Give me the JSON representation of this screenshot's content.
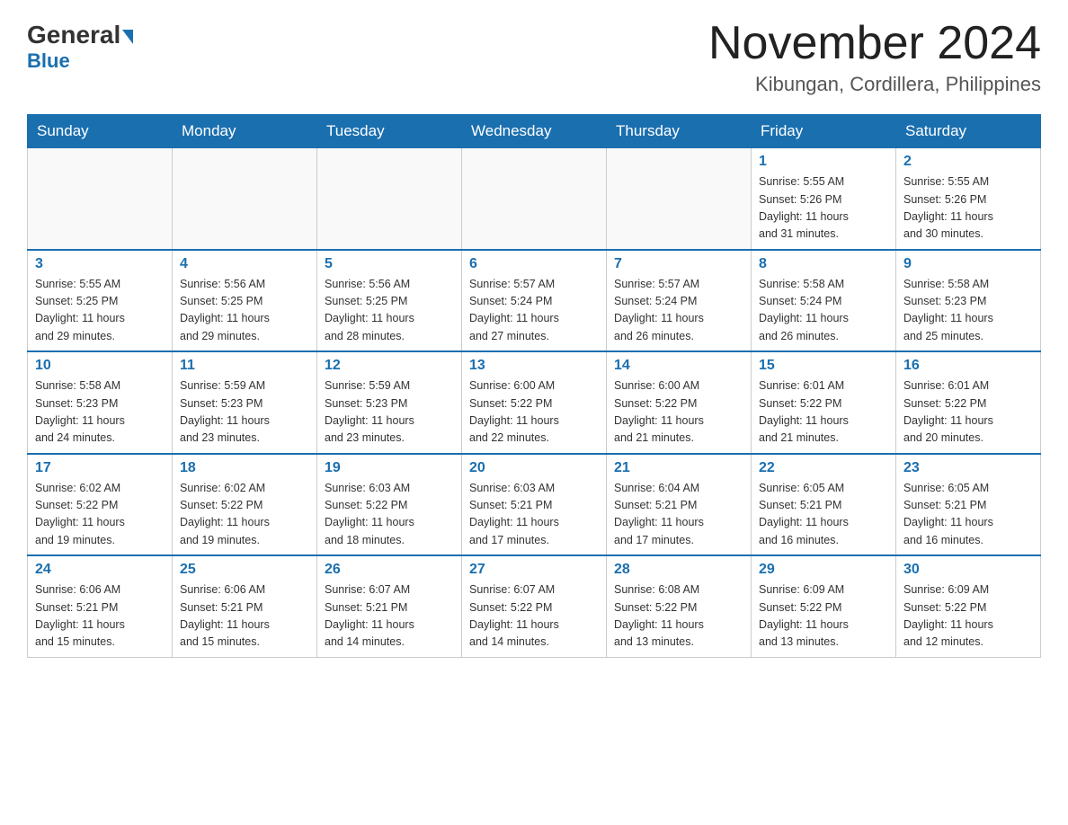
{
  "header": {
    "logo": {
      "general": "General",
      "blue": "Blue"
    },
    "title": "November 2024",
    "location": "Kibungan, Cordillera, Philippines"
  },
  "weekdays": [
    "Sunday",
    "Monday",
    "Tuesday",
    "Wednesday",
    "Thursday",
    "Friday",
    "Saturday"
  ],
  "weeks": [
    [
      {
        "day": "",
        "info": ""
      },
      {
        "day": "",
        "info": ""
      },
      {
        "day": "",
        "info": ""
      },
      {
        "day": "",
        "info": ""
      },
      {
        "day": "",
        "info": ""
      },
      {
        "day": "1",
        "info": "Sunrise: 5:55 AM\nSunset: 5:26 PM\nDaylight: 11 hours\nand 31 minutes."
      },
      {
        "day": "2",
        "info": "Sunrise: 5:55 AM\nSunset: 5:26 PM\nDaylight: 11 hours\nand 30 minutes."
      }
    ],
    [
      {
        "day": "3",
        "info": "Sunrise: 5:55 AM\nSunset: 5:25 PM\nDaylight: 11 hours\nand 29 minutes."
      },
      {
        "day": "4",
        "info": "Sunrise: 5:56 AM\nSunset: 5:25 PM\nDaylight: 11 hours\nand 29 minutes."
      },
      {
        "day": "5",
        "info": "Sunrise: 5:56 AM\nSunset: 5:25 PM\nDaylight: 11 hours\nand 28 minutes."
      },
      {
        "day": "6",
        "info": "Sunrise: 5:57 AM\nSunset: 5:24 PM\nDaylight: 11 hours\nand 27 minutes."
      },
      {
        "day": "7",
        "info": "Sunrise: 5:57 AM\nSunset: 5:24 PM\nDaylight: 11 hours\nand 26 minutes."
      },
      {
        "day": "8",
        "info": "Sunrise: 5:58 AM\nSunset: 5:24 PM\nDaylight: 11 hours\nand 26 minutes."
      },
      {
        "day": "9",
        "info": "Sunrise: 5:58 AM\nSunset: 5:23 PM\nDaylight: 11 hours\nand 25 minutes."
      }
    ],
    [
      {
        "day": "10",
        "info": "Sunrise: 5:58 AM\nSunset: 5:23 PM\nDaylight: 11 hours\nand 24 minutes."
      },
      {
        "day": "11",
        "info": "Sunrise: 5:59 AM\nSunset: 5:23 PM\nDaylight: 11 hours\nand 23 minutes."
      },
      {
        "day": "12",
        "info": "Sunrise: 5:59 AM\nSunset: 5:23 PM\nDaylight: 11 hours\nand 23 minutes."
      },
      {
        "day": "13",
        "info": "Sunrise: 6:00 AM\nSunset: 5:22 PM\nDaylight: 11 hours\nand 22 minutes."
      },
      {
        "day": "14",
        "info": "Sunrise: 6:00 AM\nSunset: 5:22 PM\nDaylight: 11 hours\nand 21 minutes."
      },
      {
        "day": "15",
        "info": "Sunrise: 6:01 AM\nSunset: 5:22 PM\nDaylight: 11 hours\nand 21 minutes."
      },
      {
        "day": "16",
        "info": "Sunrise: 6:01 AM\nSunset: 5:22 PM\nDaylight: 11 hours\nand 20 minutes."
      }
    ],
    [
      {
        "day": "17",
        "info": "Sunrise: 6:02 AM\nSunset: 5:22 PM\nDaylight: 11 hours\nand 19 minutes."
      },
      {
        "day": "18",
        "info": "Sunrise: 6:02 AM\nSunset: 5:22 PM\nDaylight: 11 hours\nand 19 minutes."
      },
      {
        "day": "19",
        "info": "Sunrise: 6:03 AM\nSunset: 5:22 PM\nDaylight: 11 hours\nand 18 minutes."
      },
      {
        "day": "20",
        "info": "Sunrise: 6:03 AM\nSunset: 5:21 PM\nDaylight: 11 hours\nand 17 minutes."
      },
      {
        "day": "21",
        "info": "Sunrise: 6:04 AM\nSunset: 5:21 PM\nDaylight: 11 hours\nand 17 minutes."
      },
      {
        "day": "22",
        "info": "Sunrise: 6:05 AM\nSunset: 5:21 PM\nDaylight: 11 hours\nand 16 minutes."
      },
      {
        "day": "23",
        "info": "Sunrise: 6:05 AM\nSunset: 5:21 PM\nDaylight: 11 hours\nand 16 minutes."
      }
    ],
    [
      {
        "day": "24",
        "info": "Sunrise: 6:06 AM\nSunset: 5:21 PM\nDaylight: 11 hours\nand 15 minutes."
      },
      {
        "day": "25",
        "info": "Sunrise: 6:06 AM\nSunset: 5:21 PM\nDaylight: 11 hours\nand 15 minutes."
      },
      {
        "day": "26",
        "info": "Sunrise: 6:07 AM\nSunset: 5:21 PM\nDaylight: 11 hours\nand 14 minutes."
      },
      {
        "day": "27",
        "info": "Sunrise: 6:07 AM\nSunset: 5:22 PM\nDaylight: 11 hours\nand 14 minutes."
      },
      {
        "day": "28",
        "info": "Sunrise: 6:08 AM\nSunset: 5:22 PM\nDaylight: 11 hours\nand 13 minutes."
      },
      {
        "day": "29",
        "info": "Sunrise: 6:09 AM\nSunset: 5:22 PM\nDaylight: 11 hours\nand 13 minutes."
      },
      {
        "day": "30",
        "info": "Sunrise: 6:09 AM\nSunset: 5:22 PM\nDaylight: 11 hours\nand 12 minutes."
      }
    ]
  ]
}
